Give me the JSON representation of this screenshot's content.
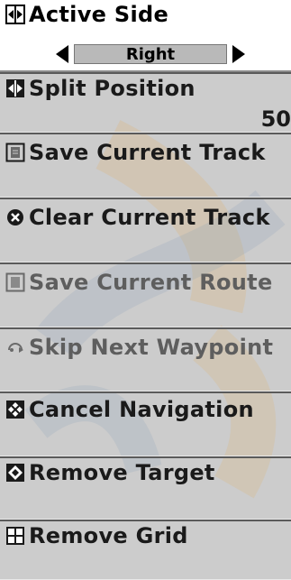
{
  "menu": {
    "items": [
      {
        "label": "Active Side",
        "icon": "split-arrows-icon",
        "selector": {
          "value": "Right"
        }
      },
      {
        "label": "Split Position",
        "icon": "split-arrows-icon",
        "value": "50"
      },
      {
        "label": "Save Current Track",
        "icon": "save-icon"
      },
      {
        "label": "Clear Current Track",
        "icon": "clear-x-icon"
      },
      {
        "label": "Save Current Route",
        "icon": "save-icon"
      },
      {
        "label": "Skip Next Waypoint",
        "icon": "skip-waypoint-icon"
      },
      {
        "label": "Cancel Navigation",
        "icon": "cancel-navigation-icon"
      },
      {
        "label": "Remove Target",
        "icon": "target-icon"
      },
      {
        "label": "Remove Grid",
        "icon": "grid-icon"
      }
    ]
  },
  "colors": {
    "menu_background": "#c9c9c9",
    "selected_background": "#ffffff",
    "text": "#1a1a1a",
    "dim_text": "#5e5e5e",
    "logo_orange": "#e8a030",
    "logo_blue": "#3a6aa0"
  }
}
